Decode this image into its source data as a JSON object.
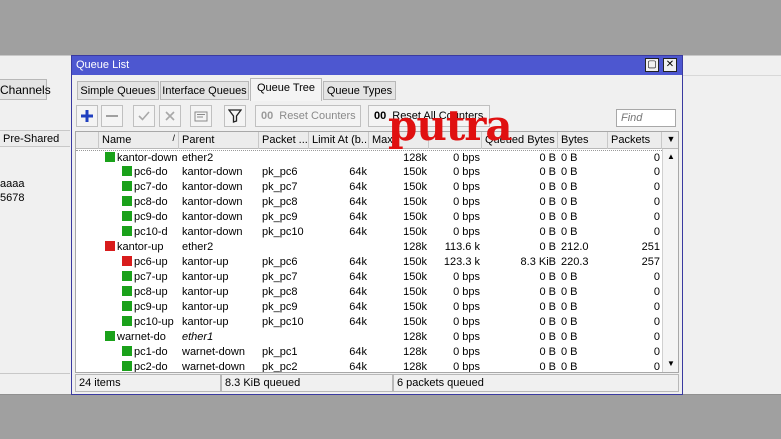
{
  "background": {
    "tab_label": "Channels",
    "column_label": "Pre-Shared",
    "values": [
      "aaaa",
      "5678"
    ]
  },
  "window": {
    "title": "Queue List",
    "restore_glyph": "▢",
    "close_glyph": "✕"
  },
  "tabs": [
    {
      "label": "Simple Queues"
    },
    {
      "label": "Interface Queues"
    },
    {
      "label": "Queue Tree"
    },
    {
      "label": "Queue Types"
    }
  ],
  "toolbar": {
    "reset_counters": "Reset Counters",
    "reset_all_counters": "Reset All Counters",
    "reset_icon_text": "00",
    "find_placeholder": "Find",
    "icons": [
      "add-icon",
      "remove-icon",
      "check-icon",
      "cross-icon",
      "comment-icon",
      "filter-icon"
    ]
  },
  "columns": [
    "Name",
    "Parent",
    "Packet ...",
    "Limit At (b...",
    "Max",
    "",
    "Queued Bytes",
    "Bytes",
    "Packets"
  ],
  "rows": [
    {
      "name": "kantor-down",
      "level": 0,
      "status": "green",
      "parent": "ether2",
      "mark": "",
      "limit": "",
      "max": "128k",
      "rate": "0 bps",
      "queued": "0 B",
      "bytes": "0 B",
      "packets": "0"
    },
    {
      "name": "pc6-do",
      "level": 1,
      "status": "green",
      "parent": "kantor-down",
      "mark": "pk_pc6",
      "limit": "64k",
      "max": "150k",
      "rate": "0 bps",
      "queued": "0 B",
      "bytes": "0 B",
      "packets": "0"
    },
    {
      "name": "pc7-do",
      "level": 1,
      "status": "green",
      "parent": "kantor-down",
      "mark": "pk_pc7",
      "limit": "64k",
      "max": "150k",
      "rate": "0 bps",
      "queued": "0 B",
      "bytes": "0 B",
      "packets": "0"
    },
    {
      "name": "pc8-do",
      "level": 1,
      "status": "green",
      "parent": "kantor-down",
      "mark": "pk_pc8",
      "limit": "64k",
      "max": "150k",
      "rate": "0 bps",
      "queued": "0 B",
      "bytes": "0 B",
      "packets": "0"
    },
    {
      "name": "pc9-do",
      "level": 1,
      "status": "green",
      "parent": "kantor-down",
      "mark": "pk_pc9",
      "limit": "64k",
      "max": "150k",
      "rate": "0 bps",
      "queued": "0 B",
      "bytes": "0 B",
      "packets": "0"
    },
    {
      "name": "pc10-d",
      "level": 1,
      "status": "green",
      "parent": "kantor-down",
      "mark": "pk_pc10",
      "limit": "64k",
      "max": "150k",
      "rate": "0 bps",
      "queued": "0 B",
      "bytes": "0 B",
      "packets": "0"
    },
    {
      "name": "kantor-up",
      "level": 0,
      "status": "red",
      "parent": "ether2",
      "mark": "",
      "limit": "",
      "max": "128k",
      "rate": "113.6 k",
      "queued": "0 B",
      "bytes": "212.0",
      "packets": "251"
    },
    {
      "name": "pc6-up",
      "level": 1,
      "status": "red",
      "parent": "kantor-up",
      "mark": "pk_pc6",
      "limit": "64k",
      "max": "150k",
      "rate": "123.3 k",
      "queued": "8.3 KiB",
      "bytes": "220.3",
      "packets": "257"
    },
    {
      "name": "pc7-up",
      "level": 1,
      "status": "green",
      "parent": "kantor-up",
      "mark": "pk_pc7",
      "limit": "64k",
      "max": "150k",
      "rate": "0 bps",
      "queued": "0 B",
      "bytes": "0 B",
      "packets": "0"
    },
    {
      "name": "pc8-up",
      "level": 1,
      "status": "green",
      "parent": "kantor-up",
      "mark": "pk_pc8",
      "limit": "64k",
      "max": "150k",
      "rate": "0 bps",
      "queued": "0 B",
      "bytes": "0 B",
      "packets": "0"
    },
    {
      "name": "pc9-up",
      "level": 1,
      "status": "green",
      "parent": "kantor-up",
      "mark": "pk_pc9",
      "limit": "64k",
      "max": "150k",
      "rate": "0 bps",
      "queued": "0 B",
      "bytes": "0 B",
      "packets": "0"
    },
    {
      "name": "pc10-up",
      "level": 1,
      "status": "green",
      "parent": "kantor-up",
      "mark": "pk_pc10",
      "limit": "64k",
      "max": "150k",
      "rate": "0 bps",
      "queued": "0 B",
      "bytes": "0 B",
      "packets": "0"
    },
    {
      "name": "warnet-do",
      "level": 0,
      "status": "green",
      "parent": "ether1",
      "parent_italic": true,
      "mark": "",
      "limit": "",
      "max": "128k",
      "rate": "0 bps",
      "queued": "0 B",
      "bytes": "0 B",
      "packets": "0"
    },
    {
      "name": "pc1-do",
      "level": 1,
      "status": "green",
      "parent": "warnet-down",
      "mark": "pk_pc1",
      "limit": "64k",
      "max": "128k",
      "rate": "0 bps",
      "queued": "0 B",
      "bytes": "0 B",
      "packets": "0"
    },
    {
      "name": "pc2-do",
      "level": 1,
      "status": "green",
      "parent": "warnet-down",
      "mark": "pk_pc2",
      "limit": "64k",
      "max": "128k",
      "rate": "0 bps",
      "queued": "0 B",
      "bytes": "0 B",
      "packets": "0"
    }
  ],
  "status": {
    "items": "24 items",
    "queued": "8.3 KiB queued",
    "packets_queued": "6 packets queued"
  },
  "watermark": "putra",
  "colors": {
    "titlebar": "#4d57d0",
    "status_green": "#1aa11a",
    "status_red": "#d81c1c",
    "watermark": "#e01010",
    "add_button": "#1f3fbf"
  }
}
